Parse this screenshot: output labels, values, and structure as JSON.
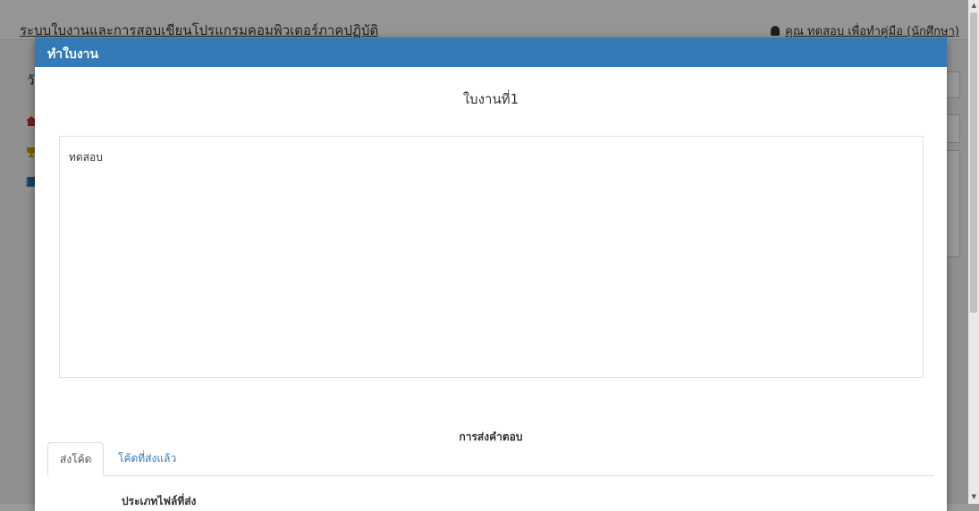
{
  "background": {
    "app_title": "ระบบใบงานและการสอบเขียนโปรแกรมคอมพิวเตอร์ภาคปฏิบัติ",
    "user_label": "คุณ ทดสอบ เพื่อทำคู่มือ (นักศึกษา)",
    "side_letter": "วั",
    "user_icon": "user-icon",
    "menu_icons": [
      "home-icon",
      "trophy-icon",
      "book-icon"
    ]
  },
  "modal": {
    "title": "ทำใบงาน",
    "sheet_title": "ใบงานที่1",
    "description": "ทดสอบ",
    "submit_section_title": "การส่งคำตอบ",
    "tabs": [
      {
        "label": "ส่งโค้ด",
        "active": true
      },
      {
        "label": "โค้ดที่ส่งแล้ว",
        "active": false
      }
    ],
    "file_type_label": "ประเภทไฟล์ที่ส่ง"
  },
  "colors": {
    "primary": "#337ab7",
    "overlay": "#000000"
  }
}
